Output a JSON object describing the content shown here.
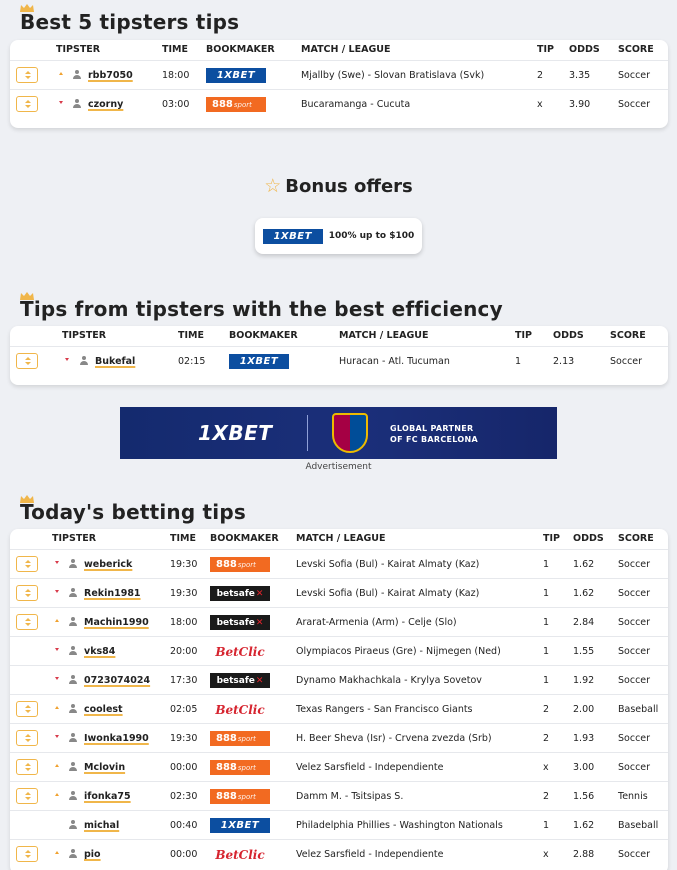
{
  "sections": {
    "best": {
      "title": "Best 5 tipsters tips"
    },
    "efficiency": {
      "title": "Tips from tipsters with the best efficiency"
    },
    "today": {
      "title": "Today's betting tips"
    }
  },
  "headers": {
    "tipster": "TIPSTER",
    "time": "TIME",
    "bookmaker": "BOOKMAKER",
    "match": "MATCH / LEAGUE",
    "tip": "TIP",
    "odds": "ODDS",
    "score": "SCORE"
  },
  "bonus": {
    "title": "Bonus offers",
    "offer_text": "100% up to $100",
    "logo": "1XBET"
  },
  "ad": {
    "brand": "1XBET",
    "partner_line1": "GLOBAL PARTNER",
    "partner_line2": "OF FC BARCELONA",
    "label": "Advertisement"
  },
  "logos": {
    "x1": "1XBET",
    "s888": "888",
    "s888_sub": "sport",
    "betsafe": "betsafe",
    "betclic": "BetClic"
  },
  "best_rows": [
    {
      "fav": true,
      "trend": "up",
      "user": "rbb7050",
      "time": "18:00",
      "book": "x1",
      "match": "Mjallby (Swe) - Slovan Bratislava (Svk)",
      "tip": "2",
      "odds": "3.35",
      "score": "Soccer"
    },
    {
      "fav": true,
      "trend": "down",
      "user": "czorny",
      "time": "03:00",
      "book": "s888",
      "match": "Bucaramanga - Cucuta",
      "tip": "x",
      "odds": "3.90",
      "score": "Soccer"
    }
  ],
  "eff_rows": [
    {
      "fav": true,
      "trend": "down",
      "user": "Bukefal",
      "time": "02:15",
      "book": "x1",
      "match": "Huracan - Atl. Tucuman",
      "tip": "1",
      "odds": "2.13",
      "score": "Soccer"
    }
  ],
  "today_rows": [
    {
      "fav": true,
      "trend": "down",
      "user": "weberick",
      "time": "19:30",
      "book": "s888",
      "match": "Levski Sofia (Bul) - Kairat Almaty (Kaz)",
      "tip": "1",
      "odds": "1.62",
      "score": "Soccer"
    },
    {
      "fav": true,
      "trend": "down",
      "user": "Rekin1981",
      "time": "19:30",
      "book": "betsafe",
      "match": "Levski Sofia (Bul) - Kairat Almaty (Kaz)",
      "tip": "1",
      "odds": "1.62",
      "score": "Soccer"
    },
    {
      "fav": true,
      "trend": "up",
      "user": "Machin1990",
      "time": "18:00",
      "book": "betsafe",
      "match": "Ararat-Armenia (Arm) - Celje (Slo)",
      "tip": "1",
      "odds": "2.84",
      "score": "Soccer"
    },
    {
      "fav": false,
      "trend": "down",
      "user": "vks84",
      "time": "20:00",
      "book": "betclic",
      "match": "Olympiacos Piraeus (Gre) - Nijmegen (Ned)",
      "tip": "1",
      "odds": "1.55",
      "score": "Soccer"
    },
    {
      "fav": false,
      "trend": "down",
      "user": "0723074024",
      "time": "17:30",
      "book": "betsafe",
      "match": "Dynamo Makhachkala - Krylya Sovetov",
      "tip": "1",
      "odds": "1.92",
      "score": "Soccer"
    },
    {
      "fav": true,
      "trend": "up",
      "user": "coolest",
      "time": "02:05",
      "book": "betclic",
      "match": "Texas Rangers - San Francisco Giants",
      "tip": "2",
      "odds": "2.00",
      "score": "Baseball"
    },
    {
      "fav": true,
      "trend": "down",
      "user": "Iwonka1990",
      "time": "19:30",
      "book": "s888",
      "match": "H. Beer Sheva (Isr) - Crvena zvezda (Srb)",
      "tip": "2",
      "odds": "1.93",
      "score": "Soccer"
    },
    {
      "fav": true,
      "trend": "up",
      "user": "Mclovin",
      "time": "00:00",
      "book": "s888",
      "match": "Velez Sarsfield - Independiente",
      "tip": "x",
      "odds": "3.00",
      "score": "Soccer"
    },
    {
      "fav": true,
      "trend": "up",
      "user": "ifonka75",
      "time": "02:30",
      "book": "s888",
      "match": "Damm M. - Tsitsipas S.",
      "tip": "2",
      "odds": "1.56",
      "score": "Tennis"
    },
    {
      "fav": false,
      "trend": "none",
      "user": "michal",
      "time": "00:40",
      "book": "x1",
      "match": "Philadelphia Phillies - Washington Nationals",
      "tip": "1",
      "odds": "1.62",
      "score": "Baseball"
    },
    {
      "fav": true,
      "trend": "up",
      "user": "pio",
      "time": "00:00",
      "book": "betclic",
      "match": "Velez Sarsfield - Independiente",
      "tip": "x",
      "odds": "2.88",
      "score": "Soccer"
    }
  ]
}
